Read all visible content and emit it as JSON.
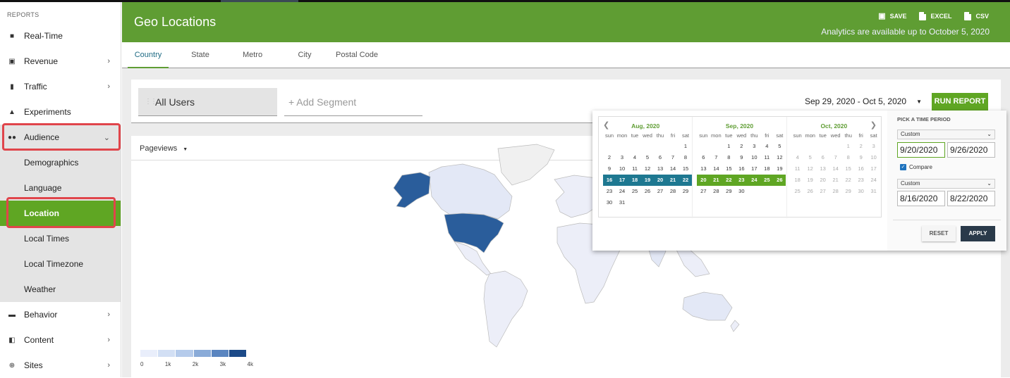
{
  "sidebar": {
    "heading": "REPORTS",
    "items": [
      {
        "label": "Real-Time",
        "icon": "video-icon"
      },
      {
        "label": "Revenue",
        "icon": "money-icon"
      },
      {
        "label": "Traffic",
        "icon": "traffic-icon"
      },
      {
        "label": "Experiments",
        "icon": "flask-icon"
      },
      {
        "label": "Audience",
        "icon": "people-icon"
      }
    ],
    "audience_sub": [
      "Demographics",
      "Language",
      "Location",
      "Local Times",
      "Local Timezone",
      "Weather"
    ],
    "bottom_items": [
      {
        "label": "Behavior",
        "icon": "chart-icon"
      },
      {
        "label": "Content",
        "icon": "content-icon"
      },
      {
        "label": "Sites",
        "icon": "globe-icon"
      }
    ],
    "active": "Location"
  },
  "header": {
    "title": "Geo Locations",
    "save": "SAVE",
    "excel": "EXCEL",
    "csv": "CSV",
    "note": "Analytics are available up to October 5, 2020",
    "color": "#5f9d33"
  },
  "tabs": [
    "Country",
    "State",
    "Metro",
    "City",
    "Postal Code"
  ],
  "segments": {
    "all_users": "All Users",
    "add_segment": "+ Add Segment"
  },
  "date_range": "Sep 29, 2020 - Oct 5, 2020",
  "run_report": "RUN REPORT",
  "metric": "Pageviews",
  "legend": {
    "labels": [
      "0",
      "1k",
      "2k",
      "3k",
      "4k"
    ],
    "colors": [
      "#e9eefb",
      "#d2dff4",
      "#b5cbeb",
      "#8aabd8",
      "#5a85c0",
      "#1c4a88"
    ]
  },
  "picker": {
    "title": "PICK A TIME PERIOD",
    "dows": [
      "sun",
      "mon",
      "tue",
      "wed",
      "thu",
      "fri",
      "sat"
    ],
    "months": [
      {
        "name": "Aug, 2020",
        "weeks": [
          [
            "",
            "",
            "",
            "",
            "",
            "",
            "1"
          ],
          [
            "2",
            "3",
            "4",
            "5",
            "6",
            "7",
            "8"
          ],
          [
            "9",
            "10",
            "11",
            "12",
            "13",
            "14",
            "15"
          ],
          [
            "16",
            "17",
            "18",
            "19",
            "20",
            "21",
            "22"
          ],
          [
            "23",
            "24",
            "25",
            "26",
            "27",
            "28",
            "29"
          ],
          [
            "30",
            "31",
            "",
            "",
            "",
            "",
            ""
          ]
        ]
      },
      {
        "name": "Sep, 2020",
        "weeks": [
          [
            "",
            "",
            "1",
            "2",
            "3",
            "4",
            "5"
          ],
          [
            "6",
            "7",
            "8",
            "9",
            "10",
            "11",
            "12"
          ],
          [
            "13",
            "14",
            "15",
            "16",
            "17",
            "18",
            "19"
          ],
          [
            "20",
            "21",
            "22",
            "23",
            "24",
            "25",
            "26"
          ],
          [
            "27",
            "28",
            "29",
            "30",
            "",
            "",
            ""
          ]
        ]
      },
      {
        "name": "Oct, 2020",
        "weeks": [
          [
            "",
            "",
            "",
            "",
            "1",
            "2",
            "3"
          ],
          [
            "4",
            "5",
            "6",
            "7",
            "8",
            "9",
            "10"
          ],
          [
            "11",
            "12",
            "13",
            "14",
            "15",
            "16",
            "17"
          ],
          [
            "18",
            "19",
            "20",
            "21",
            "22",
            "23",
            "24"
          ],
          [
            "25",
            "26",
            "27",
            "28",
            "29",
            "30",
            "31"
          ]
        ]
      }
    ],
    "period1": {
      "preset": "Custom",
      "start": "9/20/2020",
      "end": "9/26/2020"
    },
    "compare_label": "Compare",
    "period2": {
      "preset": "Custom",
      "start": "8/16/2020",
      "end": "8/22/2020"
    },
    "reset": "RESET",
    "apply": "APPLY"
  }
}
